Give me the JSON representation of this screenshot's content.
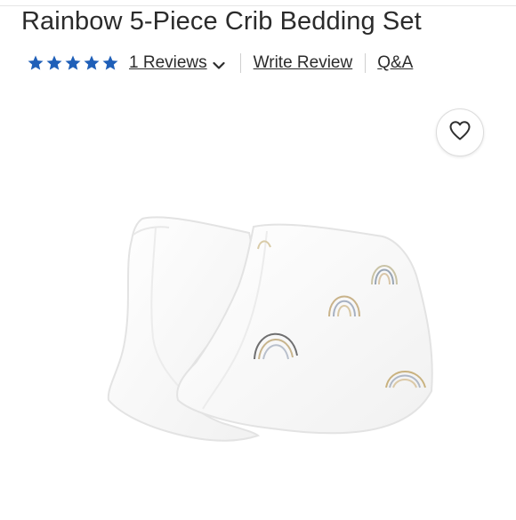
{
  "product": {
    "title": "Rainbow 5-Piece Crib Bedding Set",
    "image_alt": "White muslin burp cloths with rainbow print"
  },
  "rating": {
    "stars": 5,
    "max_stars": 5,
    "star_color": "#1f5fb8",
    "reviews_label": "1 Reviews"
  },
  "links": {
    "write_review": "Write Review",
    "qa": "Q&A"
  },
  "icons": {
    "wishlist": "heart-outline-icon",
    "dropdown": "chevron-down-icon",
    "star": "star-icon"
  }
}
